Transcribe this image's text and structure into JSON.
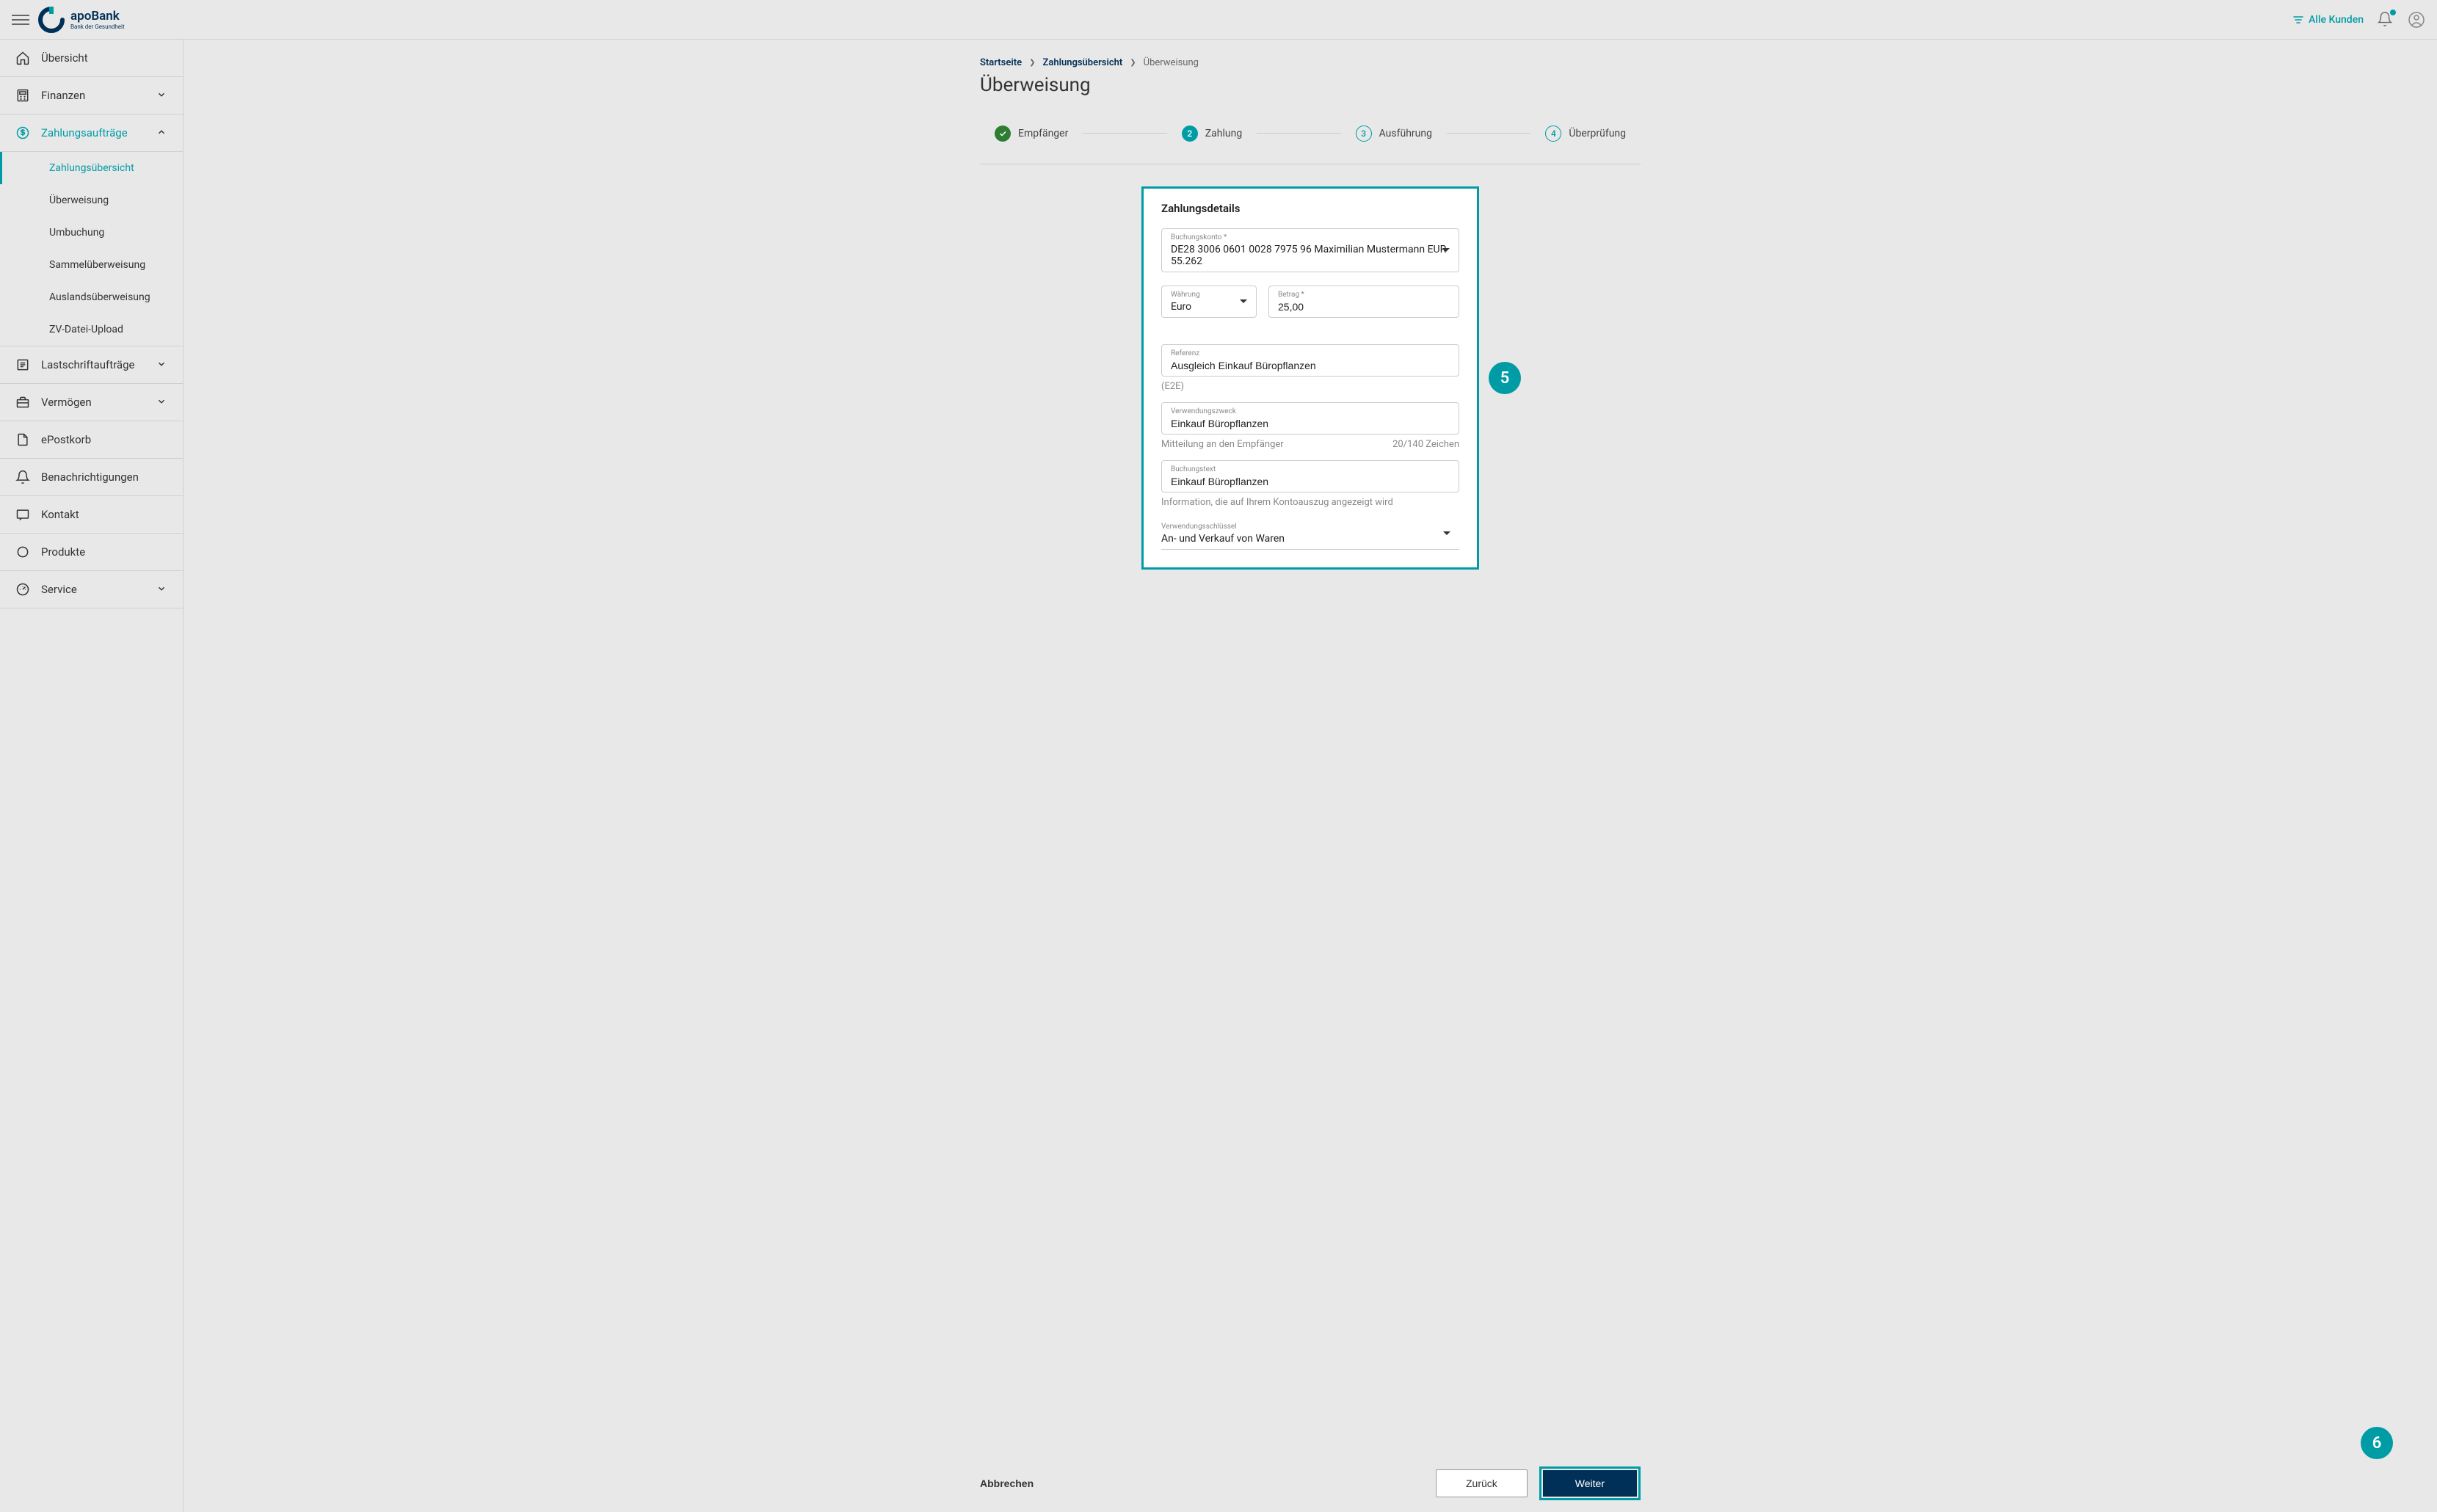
{
  "header": {
    "logo_name": "apoBank",
    "logo_tagline": "Bank der Gesundheit",
    "filter_label": "Alle Kunden"
  },
  "sidebar": {
    "items": [
      {
        "label": "Übersicht"
      },
      {
        "label": "Finanzen"
      },
      {
        "label": "Zahlungsaufträge"
      },
      {
        "label": "Lastschriftaufträge"
      },
      {
        "label": "Vermögen"
      },
      {
        "label": "ePostkorb"
      },
      {
        "label": "Benachrichtigungen"
      },
      {
        "label": "Kontakt"
      },
      {
        "label": "Produkte"
      },
      {
        "label": "Service"
      }
    ],
    "sub_items": [
      {
        "label": "Zahlungsübersicht"
      },
      {
        "label": "Überweisung"
      },
      {
        "label": "Umbuchung"
      },
      {
        "label": "Sammelüberweisung"
      },
      {
        "label": "Auslandsüberweisung"
      },
      {
        "label": "ZV-Datei-Upload"
      }
    ]
  },
  "breadcrumb": {
    "items": [
      "Startseite",
      "Zahlungsübersicht",
      "Überweisung"
    ]
  },
  "page_title": "Überweisung",
  "stepper": [
    {
      "num": "✓",
      "label": "Empfänger"
    },
    {
      "num": "2",
      "label": "Zahlung"
    },
    {
      "num": "3",
      "label": "Ausführung"
    },
    {
      "num": "4",
      "label": "Überprüfung"
    }
  ],
  "form": {
    "title": "Zahlungsdetails",
    "account_label": "Buchungskonto *",
    "account_value": "DE28 3006 0601 0028 7975 96 Maximilian Mustermann EUR 55.262",
    "currency_label": "Währung",
    "currency_value": "Euro",
    "amount_label": "Betrag *",
    "amount_value": "25,00",
    "reference_label": "Referenz",
    "reference_value": "Ausgleich Einkauf Büropflanzen",
    "reference_helper": "(E2E)",
    "purpose_label": "Verwendungszweck",
    "purpose_value": "Einkauf Büropflanzen",
    "purpose_helper_left": "Mitteilung an den Empfänger",
    "purpose_helper_right": "20/140 Zeichen",
    "bookingtext_label": "Buchungstext",
    "bookingtext_value": "Einkauf Büropflanzen",
    "bookingtext_helper": "Information, die auf Ihrem Kontoauszug angezeigt wird",
    "key_label": "Verwendungsschlüssel",
    "key_value": "An- und Verkauf von Waren"
  },
  "footer": {
    "cancel": "Abbrechen",
    "back": "Zurück",
    "next": "Weiter"
  },
  "callouts": {
    "five": "5",
    "six": "6"
  }
}
